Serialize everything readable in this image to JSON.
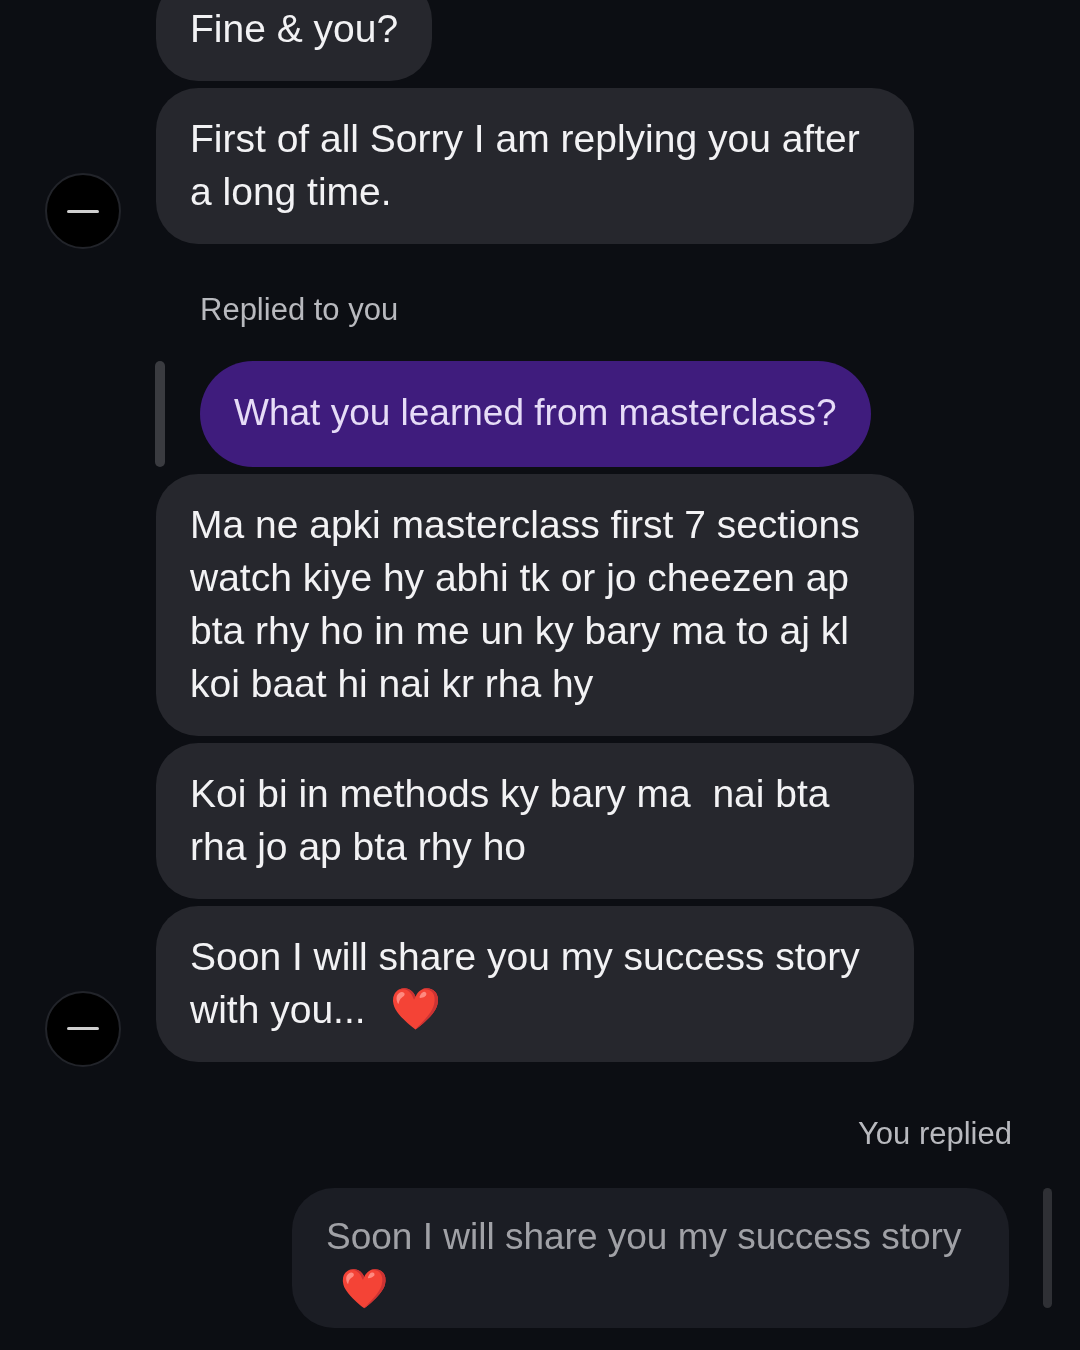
{
  "messages": [
    {
      "kind": "incoming",
      "text": "Fine & you?",
      "avatar": false
    },
    {
      "kind": "incoming",
      "text": "First of all Sorry I am replying you after a long time.",
      "avatar": true
    },
    {
      "kind": "reply_label",
      "text": "Replied to you"
    },
    {
      "kind": "quoted_outgoing",
      "text": "What you learned from masterclass?"
    },
    {
      "kind": "incoming",
      "text": "Ma ne apki masterclass first 7 sections watch kiye hy abhi tk or jo cheezen ap bta rhy ho in me un ky bary ma to aj kl koi baat hi nai kr rha hy",
      "avatar": false
    },
    {
      "kind": "incoming",
      "text": "Koi bi in methods ky bary ma  nai bta rha jo ap bta rhy ho",
      "avatar": false
    },
    {
      "kind": "incoming",
      "text": "Soon I will share you my success story with you...",
      "avatar": true,
      "emoji": "❤️"
    },
    {
      "kind": "own_reply_label",
      "text": "You replied"
    },
    {
      "kind": "quoted_incoming",
      "text": "Soon I will share you my success story",
      "emoji": "❤️"
    }
  ]
}
